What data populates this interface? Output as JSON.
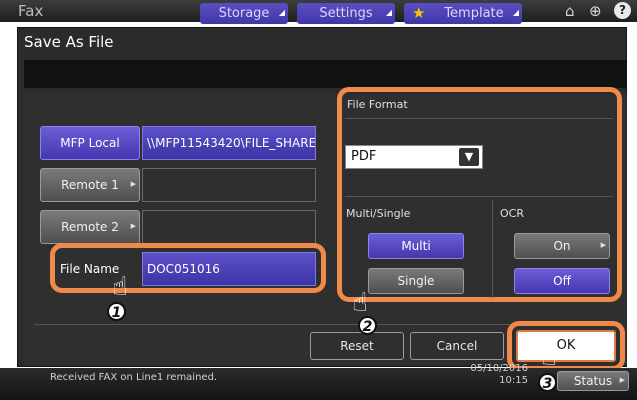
{
  "app_title": "Fax",
  "top_buttons": {
    "storage": "Storage",
    "settings": "Settings",
    "template": "Template"
  },
  "dialog": {
    "title": "Save As File",
    "mfp_local": "MFP Local",
    "mfp_path": "\\\\MFP11543420\\FILE_SHARE",
    "remote1": "Remote 1",
    "remote2": "Remote 2",
    "file_name_label": "File Name",
    "file_name_value": "DOC051016",
    "file_format_label": "File Format",
    "file_format_value": "PDF",
    "multi_single_label": "Multi/Single",
    "multi": "Multi",
    "single": "Single",
    "ocr_label": "OCR",
    "ocr_on": "On",
    "ocr_off": "Off",
    "reset": "Reset",
    "cancel": "Cancel",
    "ok": "OK"
  },
  "bottom": {
    "message": "Received FAX on Line1 remained.",
    "date": "05/10/2016",
    "time": "10:15",
    "status": "Status"
  },
  "steps": [
    "1",
    "2",
    "3"
  ],
  "colors": {
    "accent_blue": "#4f43c0",
    "highlight_orange": "#f08a4b",
    "dialog_bg": "#2b2b2b"
  }
}
